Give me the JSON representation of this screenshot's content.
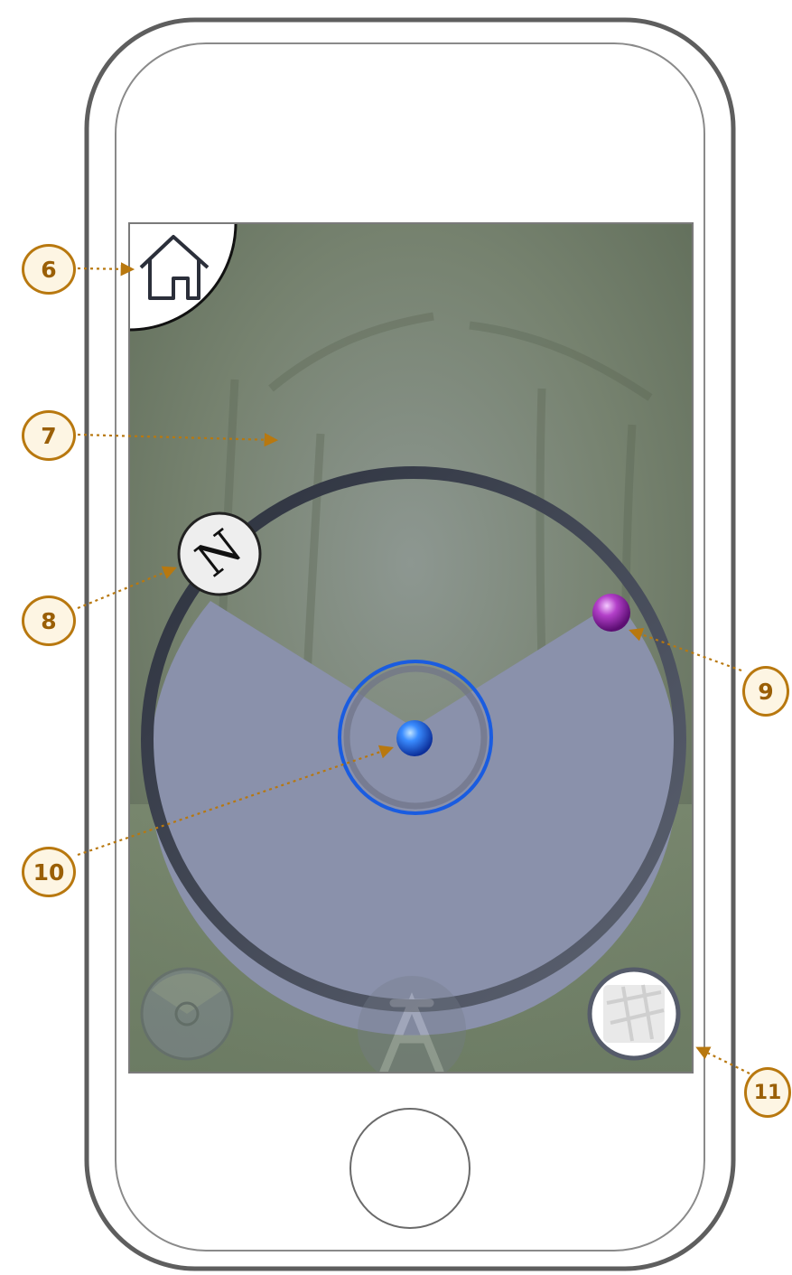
{
  "screen": {
    "compass_letter": "N",
    "controls": {
      "home": "home-icon",
      "radar_mode": "radar-icon",
      "tower_mode": "tower-icon",
      "map_mode": "map-thumbnail-icon"
    }
  },
  "annotations": [
    {
      "number": "6"
    },
    {
      "number": "7"
    },
    {
      "number": "8"
    },
    {
      "number": "9"
    },
    {
      "number": "10"
    },
    {
      "number": "11"
    }
  ],
  "colors": {
    "callout_border": "#b8780f",
    "callout_fill": "#fdf5e3",
    "radar_fill": "#8a91ab",
    "radar_ring": "#3a3f4d",
    "user_dot": "#1a5ce0",
    "target_dot": "#9b2fb0"
  }
}
